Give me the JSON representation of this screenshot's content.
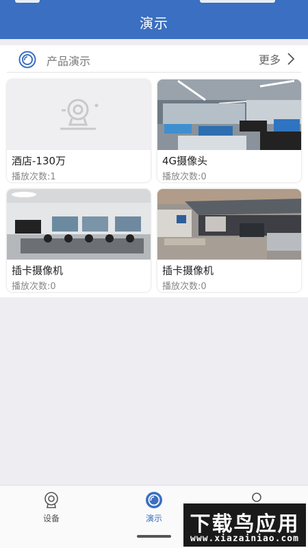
{
  "header": {
    "title": "演示"
  },
  "section": {
    "title": "产品演示",
    "more_label": "更多"
  },
  "cards": [
    {
      "name": "酒店-130万",
      "plays": "播放次数:1",
      "thumbnail": "placeholder-camera"
    },
    {
      "name": "4G摄像头",
      "plays": "播放次数:0",
      "thumbnail": "office-photo"
    },
    {
      "name": "插卡摄像机",
      "plays": "播放次数:0",
      "thumbnail": "meeting-room-photo"
    },
    {
      "name": "插卡摄像机",
      "plays": "播放次数:0",
      "thumbnail": "parking-lot-photo"
    }
  ],
  "tabs": [
    {
      "label": "设备",
      "icon": "camera-icon",
      "active": false
    },
    {
      "label": "演示",
      "icon": "demo-icon",
      "active": true
    },
    {
      "label": "",
      "icon": "user-icon",
      "active": false
    }
  ],
  "watermark": {
    "big": "下载鸟应用",
    "small": "www.xiazainiao.com"
  },
  "colors": {
    "primary": "#3a6fc1",
    "background": "#ededf2"
  }
}
